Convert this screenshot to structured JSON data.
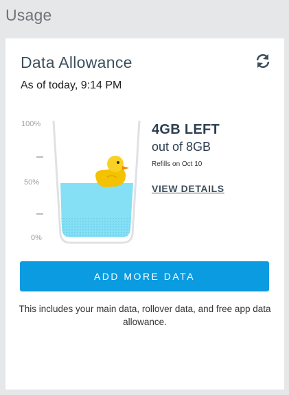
{
  "section": {
    "title": "Usage"
  },
  "card": {
    "title": "Data Allowance",
    "as_of": "As of today, 9:14 PM",
    "refresh_icon": "refresh-icon"
  },
  "gauge": {
    "labels": {
      "top": "100%",
      "middle": "50%",
      "bottom": "0%"
    },
    "fill_fraction": 0.5,
    "mascot": "duck-icon",
    "water_color": "#86e0f5",
    "water_bottom_color": "#6fd0ee"
  },
  "usage": {
    "left": "4GB LEFT",
    "total": "out of 8GB",
    "refills": "Refills on Oct 10",
    "view_details": "VIEW DETAILS"
  },
  "actions": {
    "add_data": "ADD MORE DATA"
  },
  "note": "This includes your main data, rollover data, and free app data allowance.",
  "colors": {
    "accent": "#0a9be0",
    "heading": "#3d4f5c",
    "background": "#e6e7e9"
  }
}
